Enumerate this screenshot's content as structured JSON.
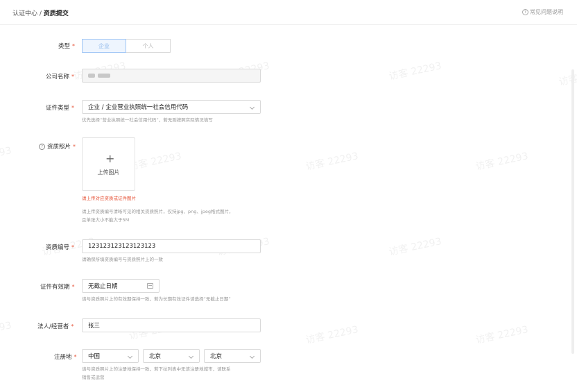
{
  "breadcrumb": {
    "parent": "认证中心",
    "separator": " / ",
    "current": "资质提交"
  },
  "help": {
    "label": "常见问题说明"
  },
  "form": {
    "type": {
      "label": "类型",
      "options": [
        "企业",
        "个人"
      ],
      "selected": "企业"
    },
    "company_name": {
      "label": "公司名称",
      "value": ""
    },
    "cert_type": {
      "label": "证件类型",
      "value": "企业 / 企业营业执照统一社会信用代码",
      "hint": "优先选择“营业执照统一社会信用代码”，若无则按照实际情况填写"
    },
    "photo": {
      "label": "资质照片",
      "upload_label": "上传图片",
      "error": "请上传对应资质或证件图片",
      "hint_line1": "请上传资质编号清晰可见的相关资质照片，仅持jpg、png、jpeg格式图片，",
      "hint_line2": "且单张大小不能大于5M"
    },
    "cert_no": {
      "label": "资质编号",
      "value": "123123123123123123",
      "hint": "请确保所填资质编号与资质照片上的一致"
    },
    "validity": {
      "label": "证件有效期",
      "value": "无截止日期",
      "hint": "请与资质照片上的有效期保持一致，若为长期有效证件请选择“无截止日期”"
    },
    "legal_person": {
      "label": "法人/经营者",
      "value": "张三"
    },
    "address": {
      "label": "注册地",
      "country": "中国",
      "province": "北京",
      "city": "北京",
      "hint_line1": "请与资质照片上的注册地保持一致，若下拉列表中无该注册地城市，请联系",
      "hint_line2": "销售或运营"
    }
  },
  "watermark": "访客 22293",
  "colors": {
    "required": "#e6553a",
    "accent": "#8bb6ea",
    "hint": "#999999"
  }
}
